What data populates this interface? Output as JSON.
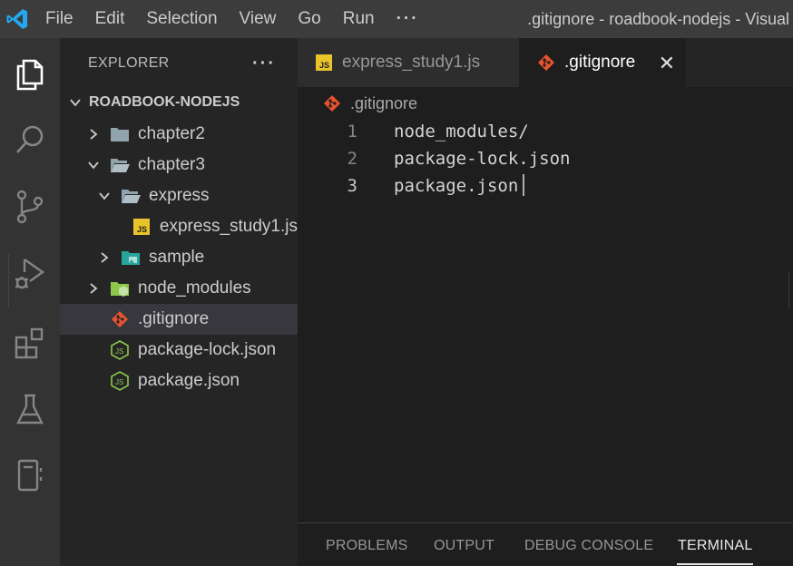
{
  "window_title": ".gitignore - roadbook-nodejs - Visual",
  "menu": [
    "File",
    "Edit",
    "Selection",
    "View",
    "Go",
    "Run",
    "···"
  ],
  "sidebar": {
    "title": "EXPLORER",
    "more": "···",
    "root": "ROADBOOK-NODEJS",
    "items": [
      {
        "label": "chapter2",
        "type": "folder",
        "expanded": false
      },
      {
        "label": "chapter3",
        "type": "folder",
        "expanded": true
      },
      {
        "label": "express",
        "type": "folder",
        "expanded": true
      },
      {
        "label": "express_study1.js",
        "type": "js-file"
      },
      {
        "label": "sample",
        "type": "image-folder",
        "expanded": false
      },
      {
        "label": "node_modules",
        "type": "node-folder",
        "expanded": false
      },
      {
        "label": ".gitignore",
        "type": "git-file",
        "selected": true
      },
      {
        "label": "package-lock.json",
        "type": "node-file"
      },
      {
        "label": "package.json",
        "type": "node-file"
      }
    ]
  },
  "tabs": [
    {
      "label": "express_study1.js",
      "active": false,
      "icon": "js-icon"
    },
    {
      "label": ".gitignore",
      "active": true,
      "icon": "git-icon",
      "close": "✕"
    }
  ],
  "breadcrumb": ".gitignore",
  "editor": {
    "lines": [
      {
        "num": "1",
        "text": "node_modules/"
      },
      {
        "num": "2",
        "text": "package-lock.json"
      },
      {
        "num": "3",
        "text": "package.json"
      }
    ]
  },
  "panel": {
    "tabs": [
      {
        "label": "PROBLEMS",
        "active": false
      },
      {
        "label": "OUTPUT",
        "active": false
      },
      {
        "label": "DEBUG CONSOLE",
        "active": false
      },
      {
        "label": "TERMINAL",
        "active": true
      }
    ]
  },
  "colors": {
    "accent_blue": "#0078d4",
    "git_orange": "#e8532f",
    "js_yellow": "#e8c32a",
    "node_green": "#8cc84b",
    "sample_teal": "#26a69a"
  }
}
